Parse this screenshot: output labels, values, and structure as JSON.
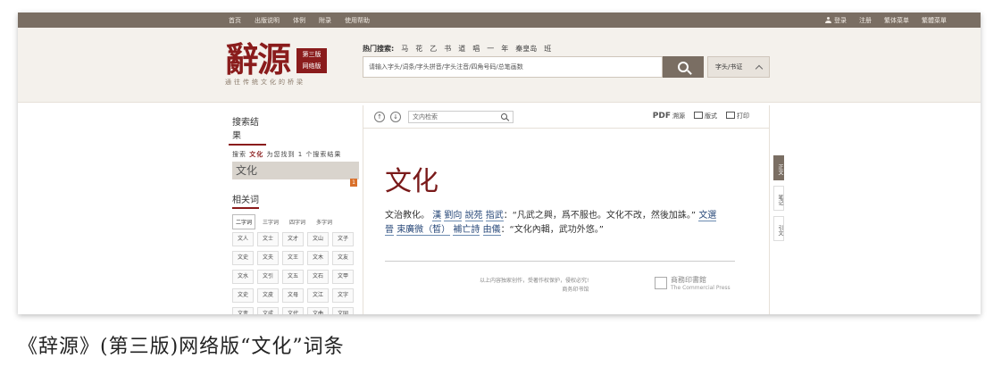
{
  "topbar": {
    "nav": [
      "首页",
      "出版说明",
      "体例",
      "附录",
      "使用帮助"
    ],
    "login": "登录",
    "register": "注册",
    "traditional": "繁体菜单",
    "simplified": "繁體菜單"
  },
  "logo": {
    "title": "辭源",
    "badge_line1": "第三版",
    "badge_line2": "网络版",
    "slogan": "通往传统文化的桥梁"
  },
  "header": {
    "hot_label": "热门搜索:",
    "hot_terms": [
      "马",
      "花",
      "乙",
      "书",
      "道",
      "唱",
      "一",
      "年",
      "秦皇岛",
      "班"
    ],
    "search_placeholder": "请输入字头/词条/字头拼音/字头注音/四角号码/总笔画数",
    "search_type": "字头/书证"
  },
  "left": {
    "results_title": "搜索结果",
    "found_prefix": "搜索",
    "found_term": "文化",
    "found_suffix": "为您找到 1 个搜索结果",
    "current_word": "文化",
    "flag": "1",
    "related_title": "相关词",
    "tabs": [
      "二字词",
      "三字词",
      "四字词",
      "多字词"
    ],
    "cells": [
      "文人",
      "文士",
      "文才",
      "文山",
      "文子",
      "文史",
      "文夫",
      "文王",
      "文木",
      "文友",
      "文水",
      "文引",
      "文五",
      "文石",
      "文甲",
      "文史",
      "文皮",
      "文母",
      "文江",
      "文字",
      "文变",
      "文成",
      "文代",
      "文曲",
      "文同"
    ]
  },
  "main": {
    "up_icon": "↑",
    "down_icon": "↓",
    "inner_search_placeholder": "文内检索",
    "pdf_label": "PDF",
    "source_label": "溯源",
    "layout_label": "版式",
    "print_label": "打印",
    "headword": "文化",
    "def_1": "文治教化。",
    "def_2": "漢",
    "def_3": "劉向",
    "def_4": "說苑",
    "def_5": "指武",
    "def_6": "：“凡武之興，爲不服也。文化不改，然後加誅。”",
    "def_7": "文選",
    "def_8": "晉",
    "def_9": "束廣微",
    "def_10": "（晳）",
    "def_11": "補亡詩",
    "def_12": "由儀",
    "def_13": "：“文化內輯，武功外悠。”",
    "copyright_1": "以上内容独家创作，受著作权保护，侵权必究!",
    "copyright_2": "商务印书馆",
    "publisher_cn": "商務印書館",
    "publisher_en": "The Commercial Press"
  },
  "sidetabs": [
    "正文",
    "笔记",
    "引文"
  ],
  "caption": "《辞源》(第三版)网络版“文化”词条"
}
